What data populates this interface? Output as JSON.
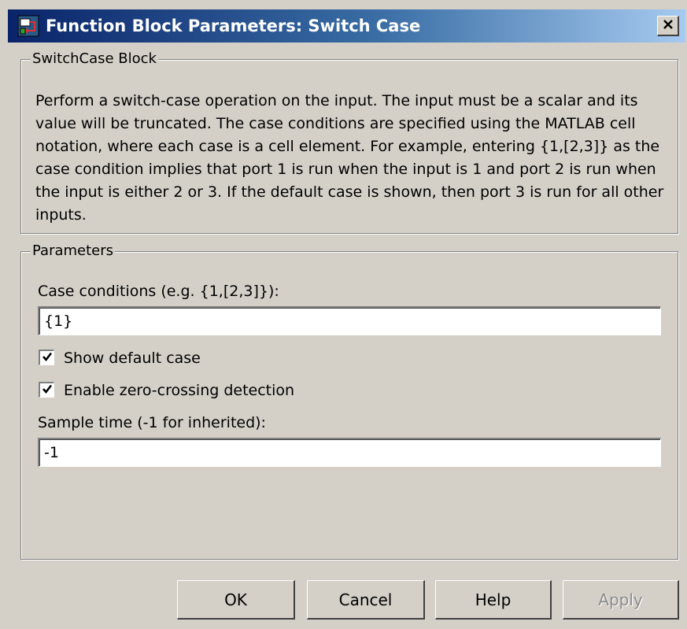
{
  "window": {
    "title": "Function Block Parameters: Switch Case"
  },
  "block_group": {
    "label": "SwitchCase Block",
    "description": "Perform a switch-case operation on the input.  The input must be a scalar and its value will be truncated.  The case conditions are specified using the MATLAB cell notation, where each case is a cell element.  For example, entering {1,[2,3]} as the case condition implies that port 1 is run when the input is 1 and port 2 is run when the input is either 2 or 3.  If the default case is shown, then port 3 is run for all other inputs."
  },
  "parameters": {
    "label": "Parameters",
    "case_conditions_label": "Case conditions (e.g. {1,[2,3]}):",
    "case_conditions_value": "{1}",
    "show_default_case_label": "Show default case",
    "show_default_case_checked": true,
    "zero_crossing_label": "Enable zero-crossing detection",
    "zero_crossing_checked": true,
    "sample_time_label": "Sample time (-1 for inherited):",
    "sample_time_value": "-1"
  },
  "buttons": {
    "ok": "OK",
    "cancel": "Cancel",
    "help": "Help",
    "apply": "Apply",
    "apply_enabled": false
  },
  "icons": {
    "app": "simulink-block-icon",
    "close": "close-icon",
    "check": "check-icon"
  },
  "colors": {
    "titlebar_start": "#0a246a",
    "titlebar_end": "#a6caf0",
    "dialog_bg": "#d4d0c8"
  }
}
